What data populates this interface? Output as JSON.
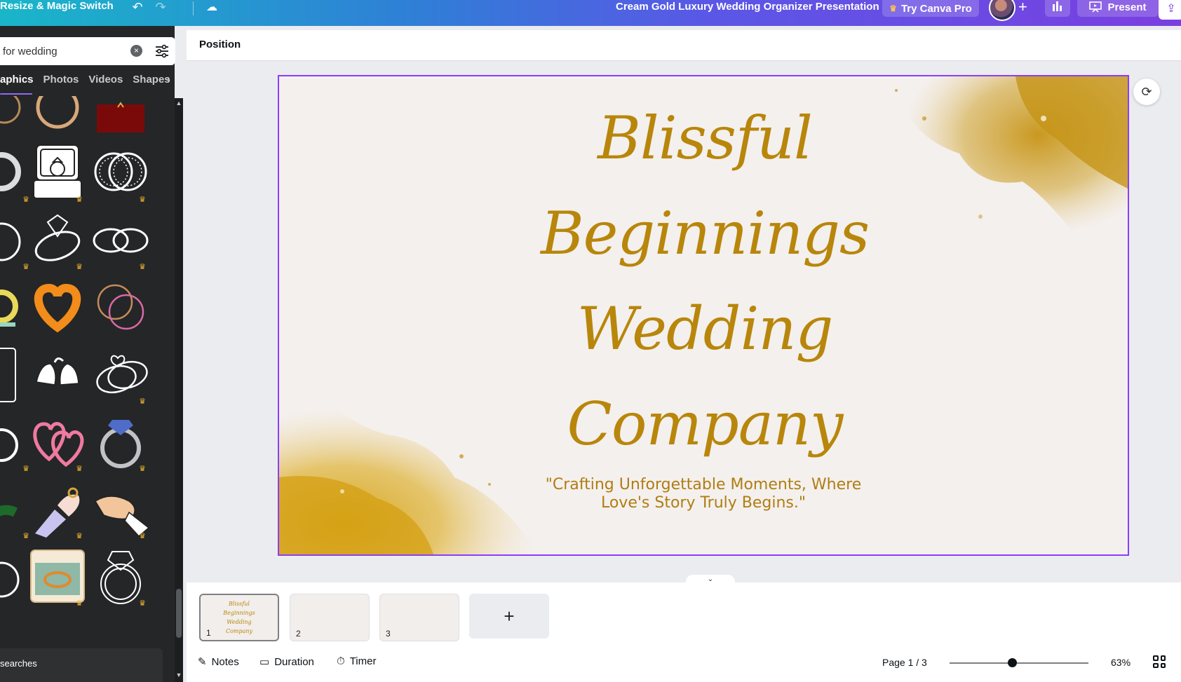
{
  "topbar": {
    "resize_label": "Resize & Magic Switch",
    "doc_title": "Cream Gold Luxury Wedding Organizer Presentation",
    "try_pro_label": "Try Canva Pro",
    "present_label": "Present"
  },
  "left_panel": {
    "search_value": "for wedding",
    "tabs": [
      "aphics",
      "Photos",
      "Videos",
      "Shapes"
    ],
    "recent_label": "searches",
    "graphics": [
      "ring-icon",
      "gift-box-icon",
      "ring-box-icon",
      "interlocked-rings-icon",
      "diamond-ring-icon",
      "wedding-bands-icon",
      "gold-hearts-rings-icon",
      "rose-gold-rings-icon",
      "bells-icon",
      "heart-rings-icon",
      "pink-hearts-icon",
      "sapphire-ring-icon",
      "hand-ring-icon",
      "hands-ring-icon",
      "ring-cushion-box-icon",
      "outline-ring-icon"
    ]
  },
  "context_bar": {
    "label": "Position"
  },
  "slide": {
    "title_lines": [
      "Blissful",
      "Beginnings",
      "Wedding",
      "Company"
    ],
    "subtitle": "\"Crafting Unforgettable Moments, Where Love's Story Truly Begins.\""
  },
  "pages": [
    {
      "number": "1",
      "active": true
    },
    {
      "number": "2",
      "active": false
    },
    {
      "number": "3",
      "active": false
    }
  ],
  "add_page_label": "+",
  "footer": {
    "notes_label": "Notes",
    "duration_label": "Duration",
    "timer_label": "Timer",
    "page_indicator": "Page 1 / 3",
    "zoom_value": "63%",
    "zoom_fraction": 0.45
  },
  "colors": {
    "accent": "#8b3dff",
    "gold": "#b8860b",
    "slide_bg": "#f4f0ee",
    "panel_bg": "#252627"
  }
}
